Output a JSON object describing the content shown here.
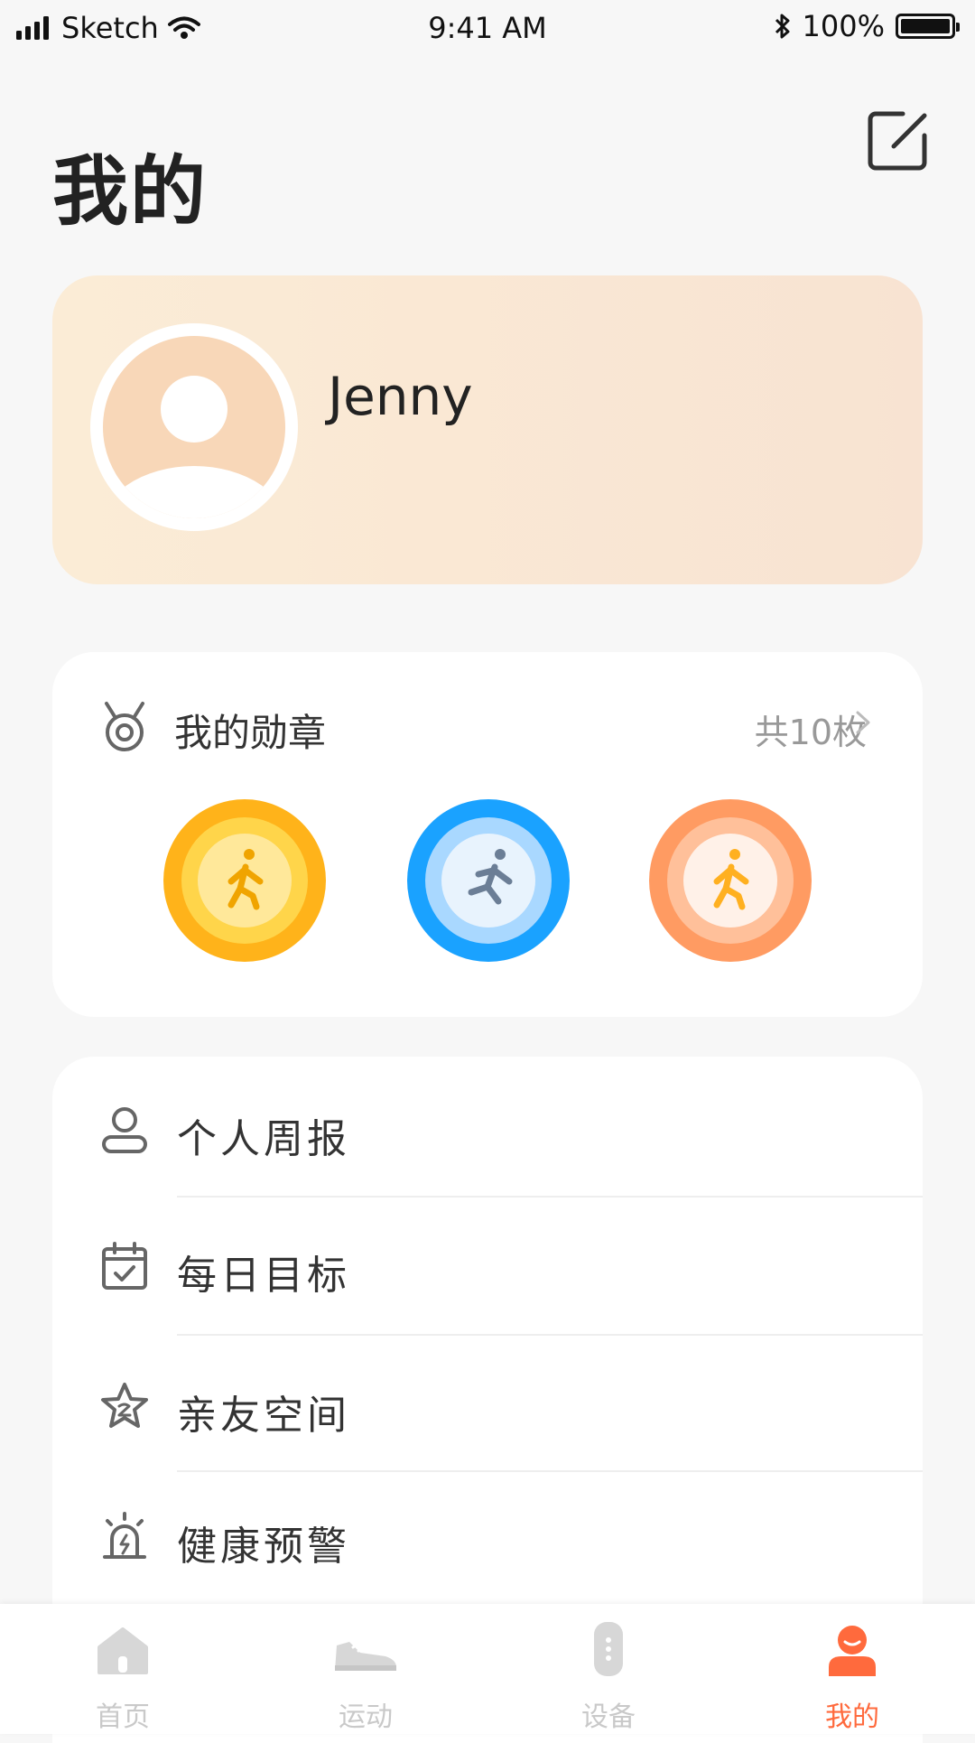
{
  "status_bar": {
    "carrier": "Sketch",
    "time": "9:41 AM",
    "battery": "100%"
  },
  "header": {
    "title": "我的",
    "edit_icon": "edit-icon"
  },
  "profile": {
    "name": "Jenny",
    "avatar_icon": "user-avatar-icon"
  },
  "medals": {
    "title": "我的勋章",
    "count_label": "共10枚",
    "items": [
      {
        "icon": "walking-medal",
        "color": "#ffb51e"
      },
      {
        "icon": "running-medal",
        "color": "#1aa2ff"
      },
      {
        "icon": "walking-medal",
        "color": "#ff9b62"
      }
    ]
  },
  "menu": {
    "items": [
      {
        "label": "个人周报",
        "icon": "person-icon"
      },
      {
        "label": "每日目标",
        "icon": "calendar-check-icon"
      },
      {
        "label": "亲友空间",
        "icon": "star-icon"
      },
      {
        "label": "健康预警",
        "icon": "alarm-icon"
      }
    ]
  },
  "tabs": {
    "items": [
      {
        "label": "首页",
        "icon": "home-icon"
      },
      {
        "label": "运动",
        "icon": "shoe-icon"
      },
      {
        "label": "设备",
        "icon": "watch-icon"
      },
      {
        "label": "我的",
        "icon": "me-icon"
      }
    ],
    "active_index": 3,
    "active_color": "#ff6a3d",
    "inactive_color": "#c9c9c9"
  }
}
